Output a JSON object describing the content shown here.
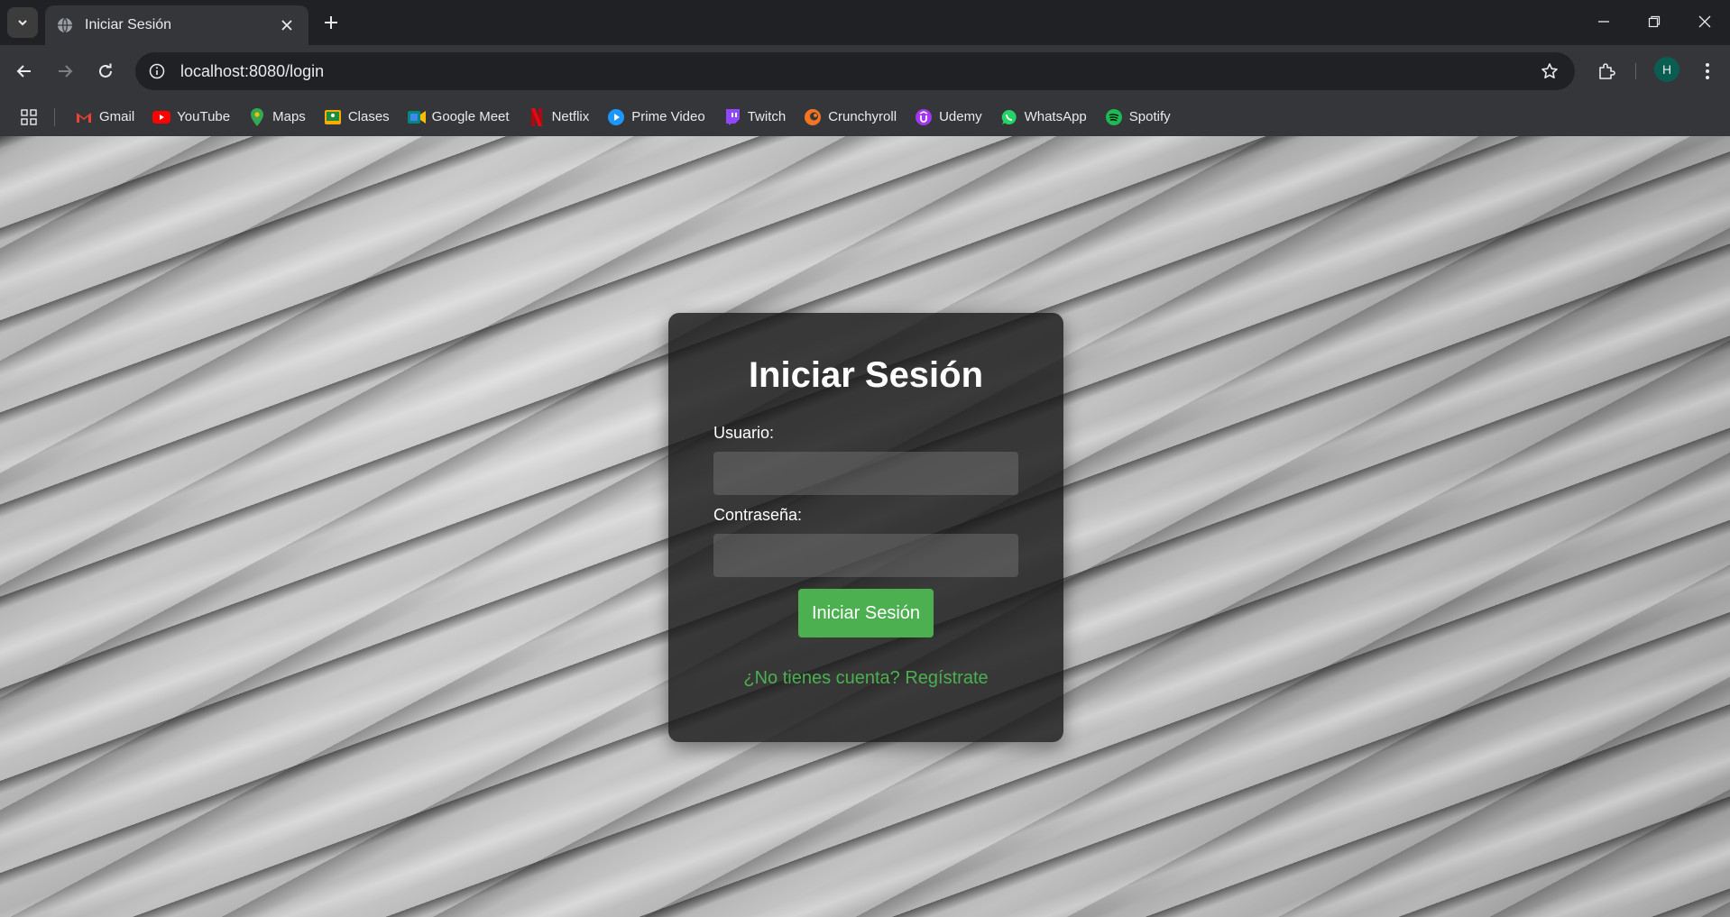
{
  "browser": {
    "tab": {
      "title": "Iniciar Sesión",
      "favicon": "globe-icon"
    },
    "address_bar": {
      "url": "localhost:8080/login"
    },
    "profile_initial": "H",
    "bookmarks": [
      {
        "label": "Gmail",
        "icon": "gmail-icon",
        "color": "#ea4335"
      },
      {
        "label": "YouTube",
        "icon": "youtube-icon",
        "color": "#ff0000"
      },
      {
        "label": "Maps",
        "icon": "maps-icon",
        "color": "#34a853"
      },
      {
        "label": "Clases",
        "icon": "classroom-icon",
        "color": "#f9ab00"
      },
      {
        "label": "Google Meet",
        "icon": "meet-icon",
        "color": "#00897b"
      },
      {
        "label": "Netflix",
        "icon": "netflix-icon",
        "color": "#e50914"
      },
      {
        "label": "Prime Video",
        "icon": "prime-video-icon",
        "color": "#1a98ff"
      },
      {
        "label": "Twitch",
        "icon": "twitch-icon",
        "color": "#9146ff"
      },
      {
        "label": "Crunchyroll",
        "icon": "crunchyroll-icon",
        "color": "#f47521"
      },
      {
        "label": "Udemy",
        "icon": "udemy-icon",
        "color": "#a435f0"
      },
      {
        "label": "WhatsApp",
        "icon": "whatsapp-icon",
        "color": "#25d366"
      },
      {
        "label": "Spotify",
        "icon": "spotify-icon",
        "color": "#1db954"
      }
    ]
  },
  "login": {
    "title": "Iniciar Sesión",
    "username_label": "Usuario:",
    "username_value": "",
    "password_label": "Contraseña:",
    "password_value": "",
    "submit_label": "Iniciar Sesión",
    "register_link": "¿No tienes cuenta? Regístrate",
    "accent_color": "#4caf50"
  }
}
